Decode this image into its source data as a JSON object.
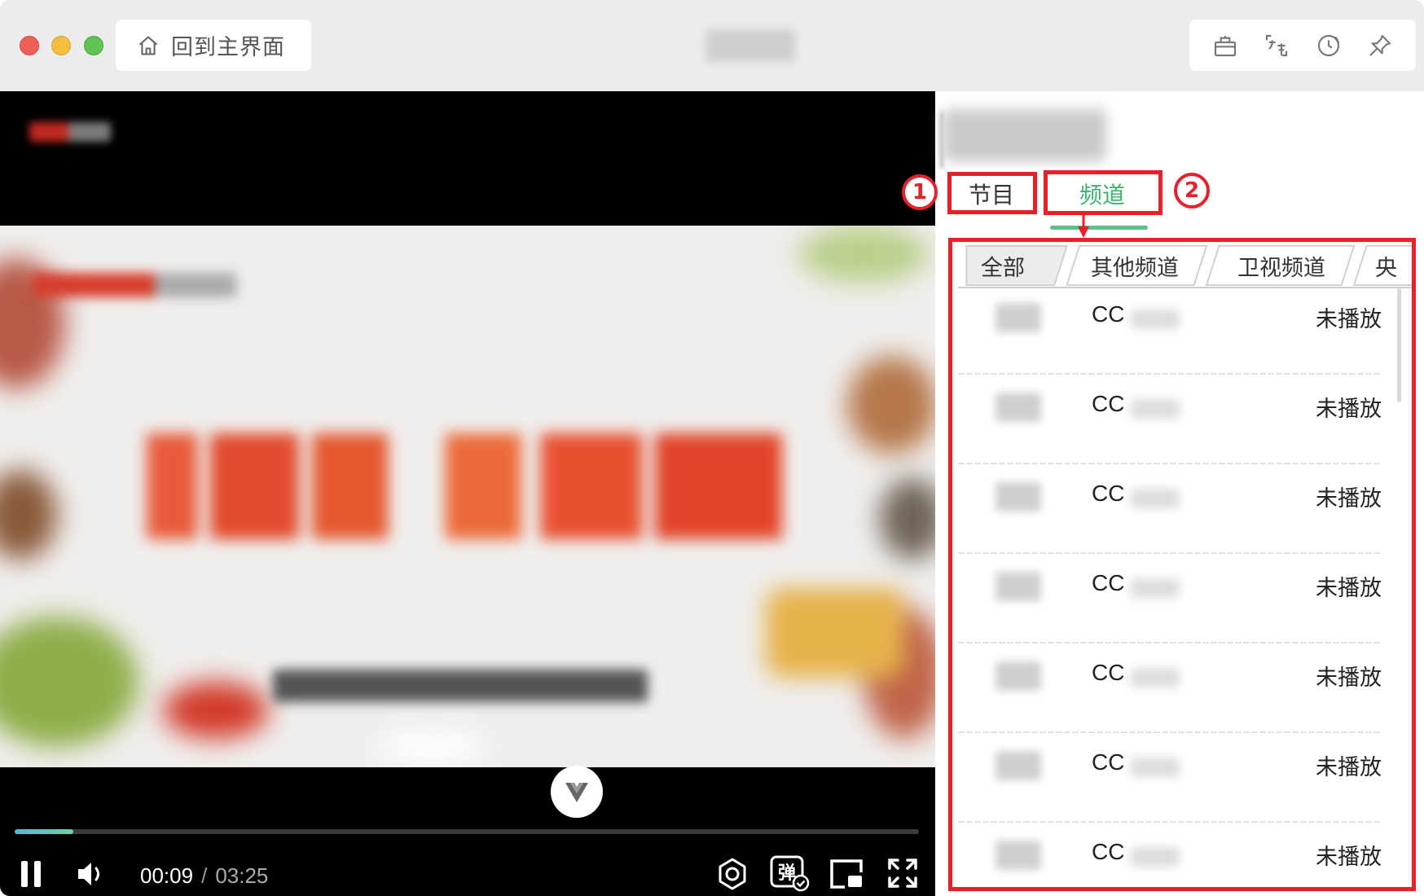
{
  "titlebar": {
    "home_label": "回到主界面",
    "icons": [
      "gift-icon",
      "translate-icon",
      "history-icon",
      "pin-icon"
    ]
  },
  "player": {
    "current_time": "00:09",
    "separator": "/",
    "total_time": "03:25",
    "progress_fraction": 0.065,
    "danmaku_icon_text": "弹"
  },
  "side": {
    "tabs": [
      {
        "label": "节目",
        "active": false
      },
      {
        "label": "频道",
        "active": true
      }
    ],
    "subtabs": [
      {
        "label": "全部",
        "active": true
      },
      {
        "label": "其他频道",
        "active": false
      },
      {
        "label": "卫视频道",
        "active": false
      },
      {
        "label": "央",
        "active": false
      }
    ],
    "channels": [
      {
        "name": "CC",
        "status": "未播放"
      },
      {
        "name": "CC",
        "status": "未播放"
      },
      {
        "name": "CC",
        "status": "未播放"
      },
      {
        "name": "CC",
        "status": "未播放"
      },
      {
        "name": "CC",
        "status": "未播放"
      },
      {
        "name": "CC",
        "status": "未播放"
      },
      {
        "name": "CC",
        "status": "未播放"
      }
    ]
  },
  "annotations": {
    "marker_1": "1",
    "marker_2": "2",
    "color": "#e8202a"
  },
  "colors": {
    "accent_green": "#3eb370",
    "progress_start": "#55b6d8",
    "progress_end": "#66d1a5"
  }
}
